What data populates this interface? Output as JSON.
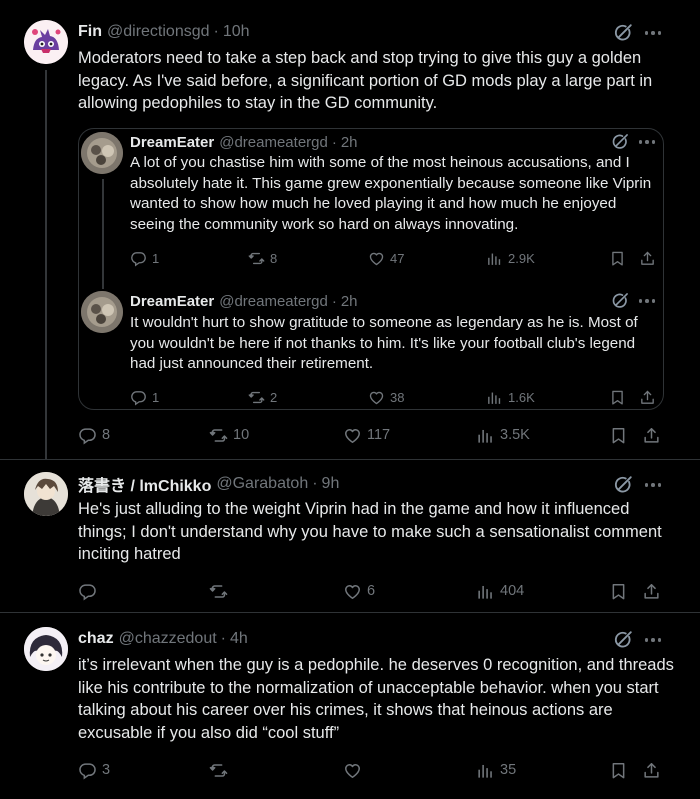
{
  "tweets": [
    {
      "name": "Fin",
      "handle": "@directionsgd",
      "time": "10h",
      "text": "Moderators need to take a step back and stop trying to give this guy a golden legacy. As I've said before, a significant portion of GD mods play a large part in allowing pedophiles to stay in the GD community.",
      "replies": "8",
      "reposts": "10",
      "likes": "117",
      "views": "3.5K"
    },
    {
      "name": "落書き / lmChikko",
      "handle": "@Garabatoh",
      "time": "9h",
      "text": "He's just alluding to the weight Viprin had in the game and how it influenced things; I don't understand why you have to make such a sensationalist comment inciting hatred",
      "replies": "",
      "reposts": "",
      "likes": "6",
      "views": "404"
    },
    {
      "name": "chaz",
      "handle": "@chazzedout",
      "time": "4h",
      "text": "it’s irrelevant when the guy is a pedophile. he deserves 0 recognition, and threads like his contribute to the normalization of unacceptable behavior. when you start talking about his career over his crimes, it shows that heinous actions are excusable if you also did “cool stuff”",
      "replies": "3",
      "reposts": "",
      "likes": "",
      "views": "35"
    }
  ],
  "quoted": [
    {
      "name": "DreamEater",
      "handle": "@dreameatergd",
      "time": "2h",
      "text": "A lot of you chastise him with some of the most heinous accusations, and I absolutely hate it. This game grew exponentially because someone like Viprin wanted to show how much he loved playing it and how much he enjoyed seeing the community work so hard on always innovating.",
      "replies": "1",
      "reposts": "8",
      "likes": "47",
      "views": "2.9K"
    },
    {
      "name": "DreamEater",
      "handle": "@dreameatergd",
      "time": "2h",
      "text": "It wouldn't hurt to show gratitude to someone as legendary as he is. Most of you wouldn't be here if not thanks to him. It's like your football club's legend had just announced their retirement.",
      "replies": "1",
      "reposts": "2",
      "likes": "38",
      "views": "1.6K"
    }
  ],
  "separators": {
    "dot": "·"
  },
  "colors": {
    "background": "#000000",
    "text": "#e7e9ea",
    "muted": "#71767b",
    "border": "#2f3336"
  }
}
